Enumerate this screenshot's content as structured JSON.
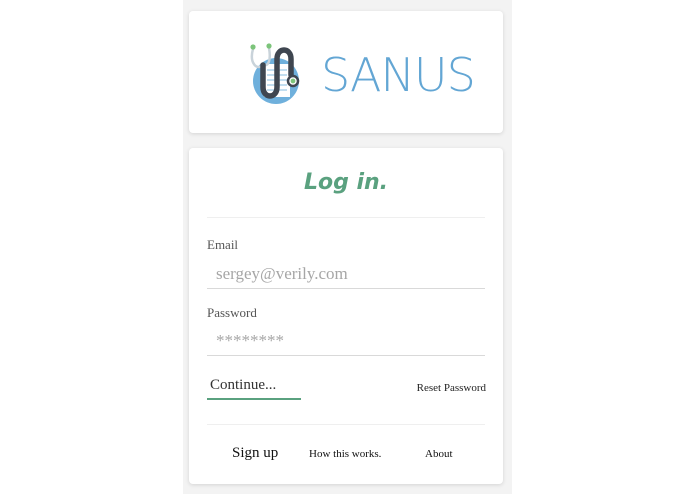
{
  "brand": {
    "name": "SANUS",
    "color": "#63a6d4"
  },
  "login": {
    "title": "Log in.",
    "title_color": "#5aa17f",
    "email_label": "Email",
    "email_placeholder": "sergey@verily.com",
    "password_label": "Password",
    "password_placeholder": "********",
    "continue_label": "Continue...",
    "continue_underline_color": "#5aa17f",
    "reset_label": "Reset Password"
  },
  "footer": {
    "signup_label": "Sign up",
    "how_label": "How this works.",
    "about_label": "About"
  }
}
